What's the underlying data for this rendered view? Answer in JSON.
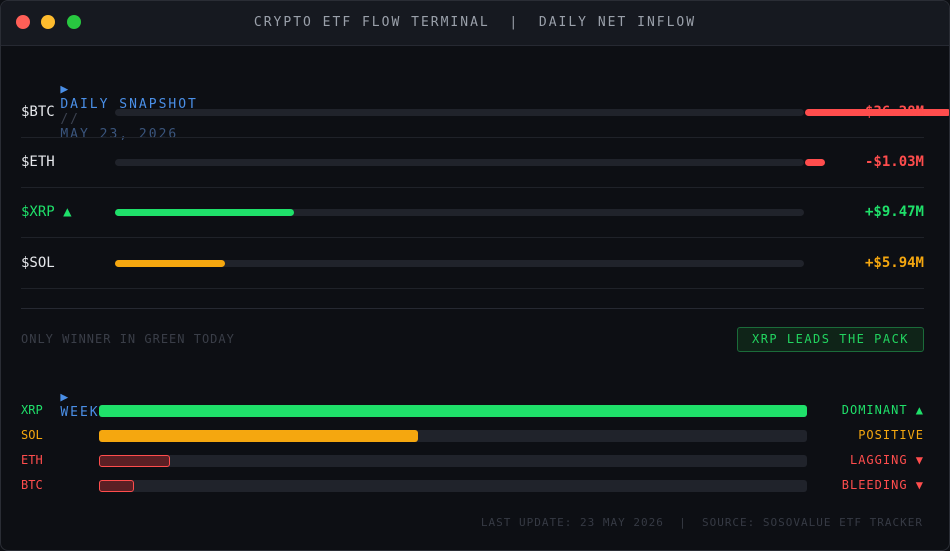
{
  "window": {
    "title": "CRYPTO ETF FLOW TERMINAL  |  DAILY NET INFLOW"
  },
  "snapshot": {
    "arrow": "▶",
    "label": "DAILY SNAPSHOT",
    "separator": "//",
    "date": "MAY 23, 2026",
    "rows": [
      {
        "ticker": "$BTC",
        "value": "-$36.28M",
        "direction": "negative",
        "color": "#ff4d4d"
      },
      {
        "ticker": "$ETH",
        "value": "-$1.03M",
        "direction": "negative",
        "color": "#ff4d4d"
      },
      {
        "ticker": "$XRP ▲",
        "value": "+$9.47M",
        "direction": "positive",
        "color": "#1fe06a"
      },
      {
        "ticker": "$SOL",
        "value": "+$5.94M",
        "direction": "positive",
        "color": "#f5a70f"
      }
    ]
  },
  "note": "ONLY WINNER IN GREEN TODAY",
  "leader_badge": "XRP LEADS THE PACK",
  "week_to_date": {
    "arrow": "▶",
    "label": "WEEK-TO-DATE FLOW DOMINANCE",
    "rows": [
      {
        "ticker": "XRP",
        "status": "DOMINANT ▲",
        "level": 1.0,
        "color": "#1fe06a"
      },
      {
        "ticker": "SOL",
        "status": "POSITIVE",
        "level": 0.45,
        "color": "#f5a70f"
      },
      {
        "ticker": "ETH",
        "status": "LAGGING ▼",
        "level": 0.1,
        "color": "#ff4d4d"
      },
      {
        "ticker": "BTC",
        "status": "BLEEDING ▼",
        "level": 0.05,
        "color": "#ff4d4d"
      }
    ]
  },
  "footer": "LAST UPDATE: 23 MAY 2026  |  SOURCE: SOSOVALUE ETF TRACKER"
}
